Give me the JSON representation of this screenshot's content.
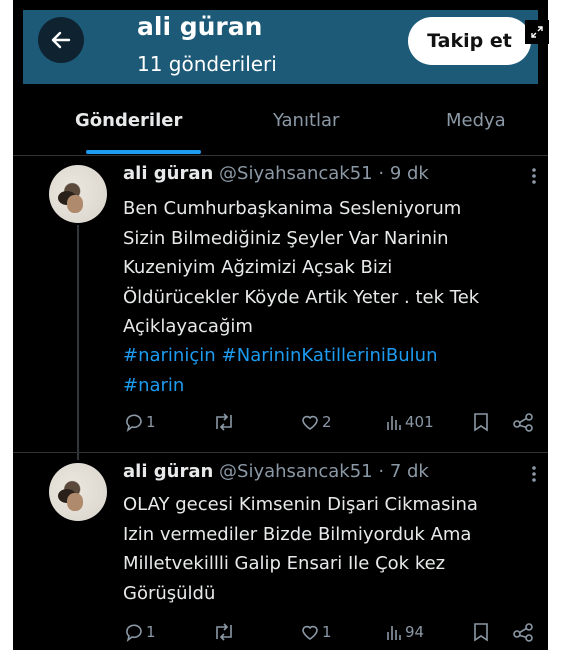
{
  "header": {
    "profile_name": "ali güran",
    "post_count": "11 gönderileri",
    "follow_label": "Takip et"
  },
  "tabs": [
    {
      "label": "Gönderiler",
      "active": true
    },
    {
      "label": "Yanıtlar",
      "active": false
    },
    {
      "label": "Medya",
      "active": false
    }
  ],
  "tweets": [
    {
      "name": "ali güran",
      "handle": "@Siyahsancak51",
      "separator": "·",
      "time": "9 dk",
      "text": "Ben Cumhurbaşkanima Sesleniyorum\nSizin Bilmediğiniz Şeyler Var  Narinin\nKuzeniyim Ağzimizi Açsak Bizi\nÖldürücekler Köyde Artik Yeter . tek Tek\nAçiklayacağim",
      "hashtags": [
        "#nariniçin",
        "#NarininKatilleriniBulun",
        "#narin"
      ],
      "replies": "1",
      "retweets": "",
      "likes": "2",
      "views": "401"
    },
    {
      "name": "ali güran",
      "handle": "@Siyahsancak51",
      "separator": "·",
      "time": "7 dk",
      "text": "OLAY gecesi Kimsenin Dişari Cikmasina\nIzin vermediler Bizde Bilmiyorduk Ama\nMilletvekillli Galip Ensari Ile Çok kez\nGörüşüldü",
      "hashtags": [],
      "replies": "1",
      "retweets": "",
      "likes": "1",
      "views": "94"
    }
  ],
  "icons": {
    "back": "arrow-left-icon",
    "expand": "expand-icon",
    "more": "more-vertical-icon",
    "reply": "reply-icon",
    "retweet": "retweet-icon",
    "like": "heart-icon",
    "views": "views-icon",
    "bookmark": "bookmark-icon",
    "share": "share-icon"
  },
  "colors": {
    "header_bg": "#1d5a78",
    "background": "#000000",
    "text": "#e7e9ea",
    "muted": "#8b98a5",
    "accent": "#1d9bf0"
  }
}
